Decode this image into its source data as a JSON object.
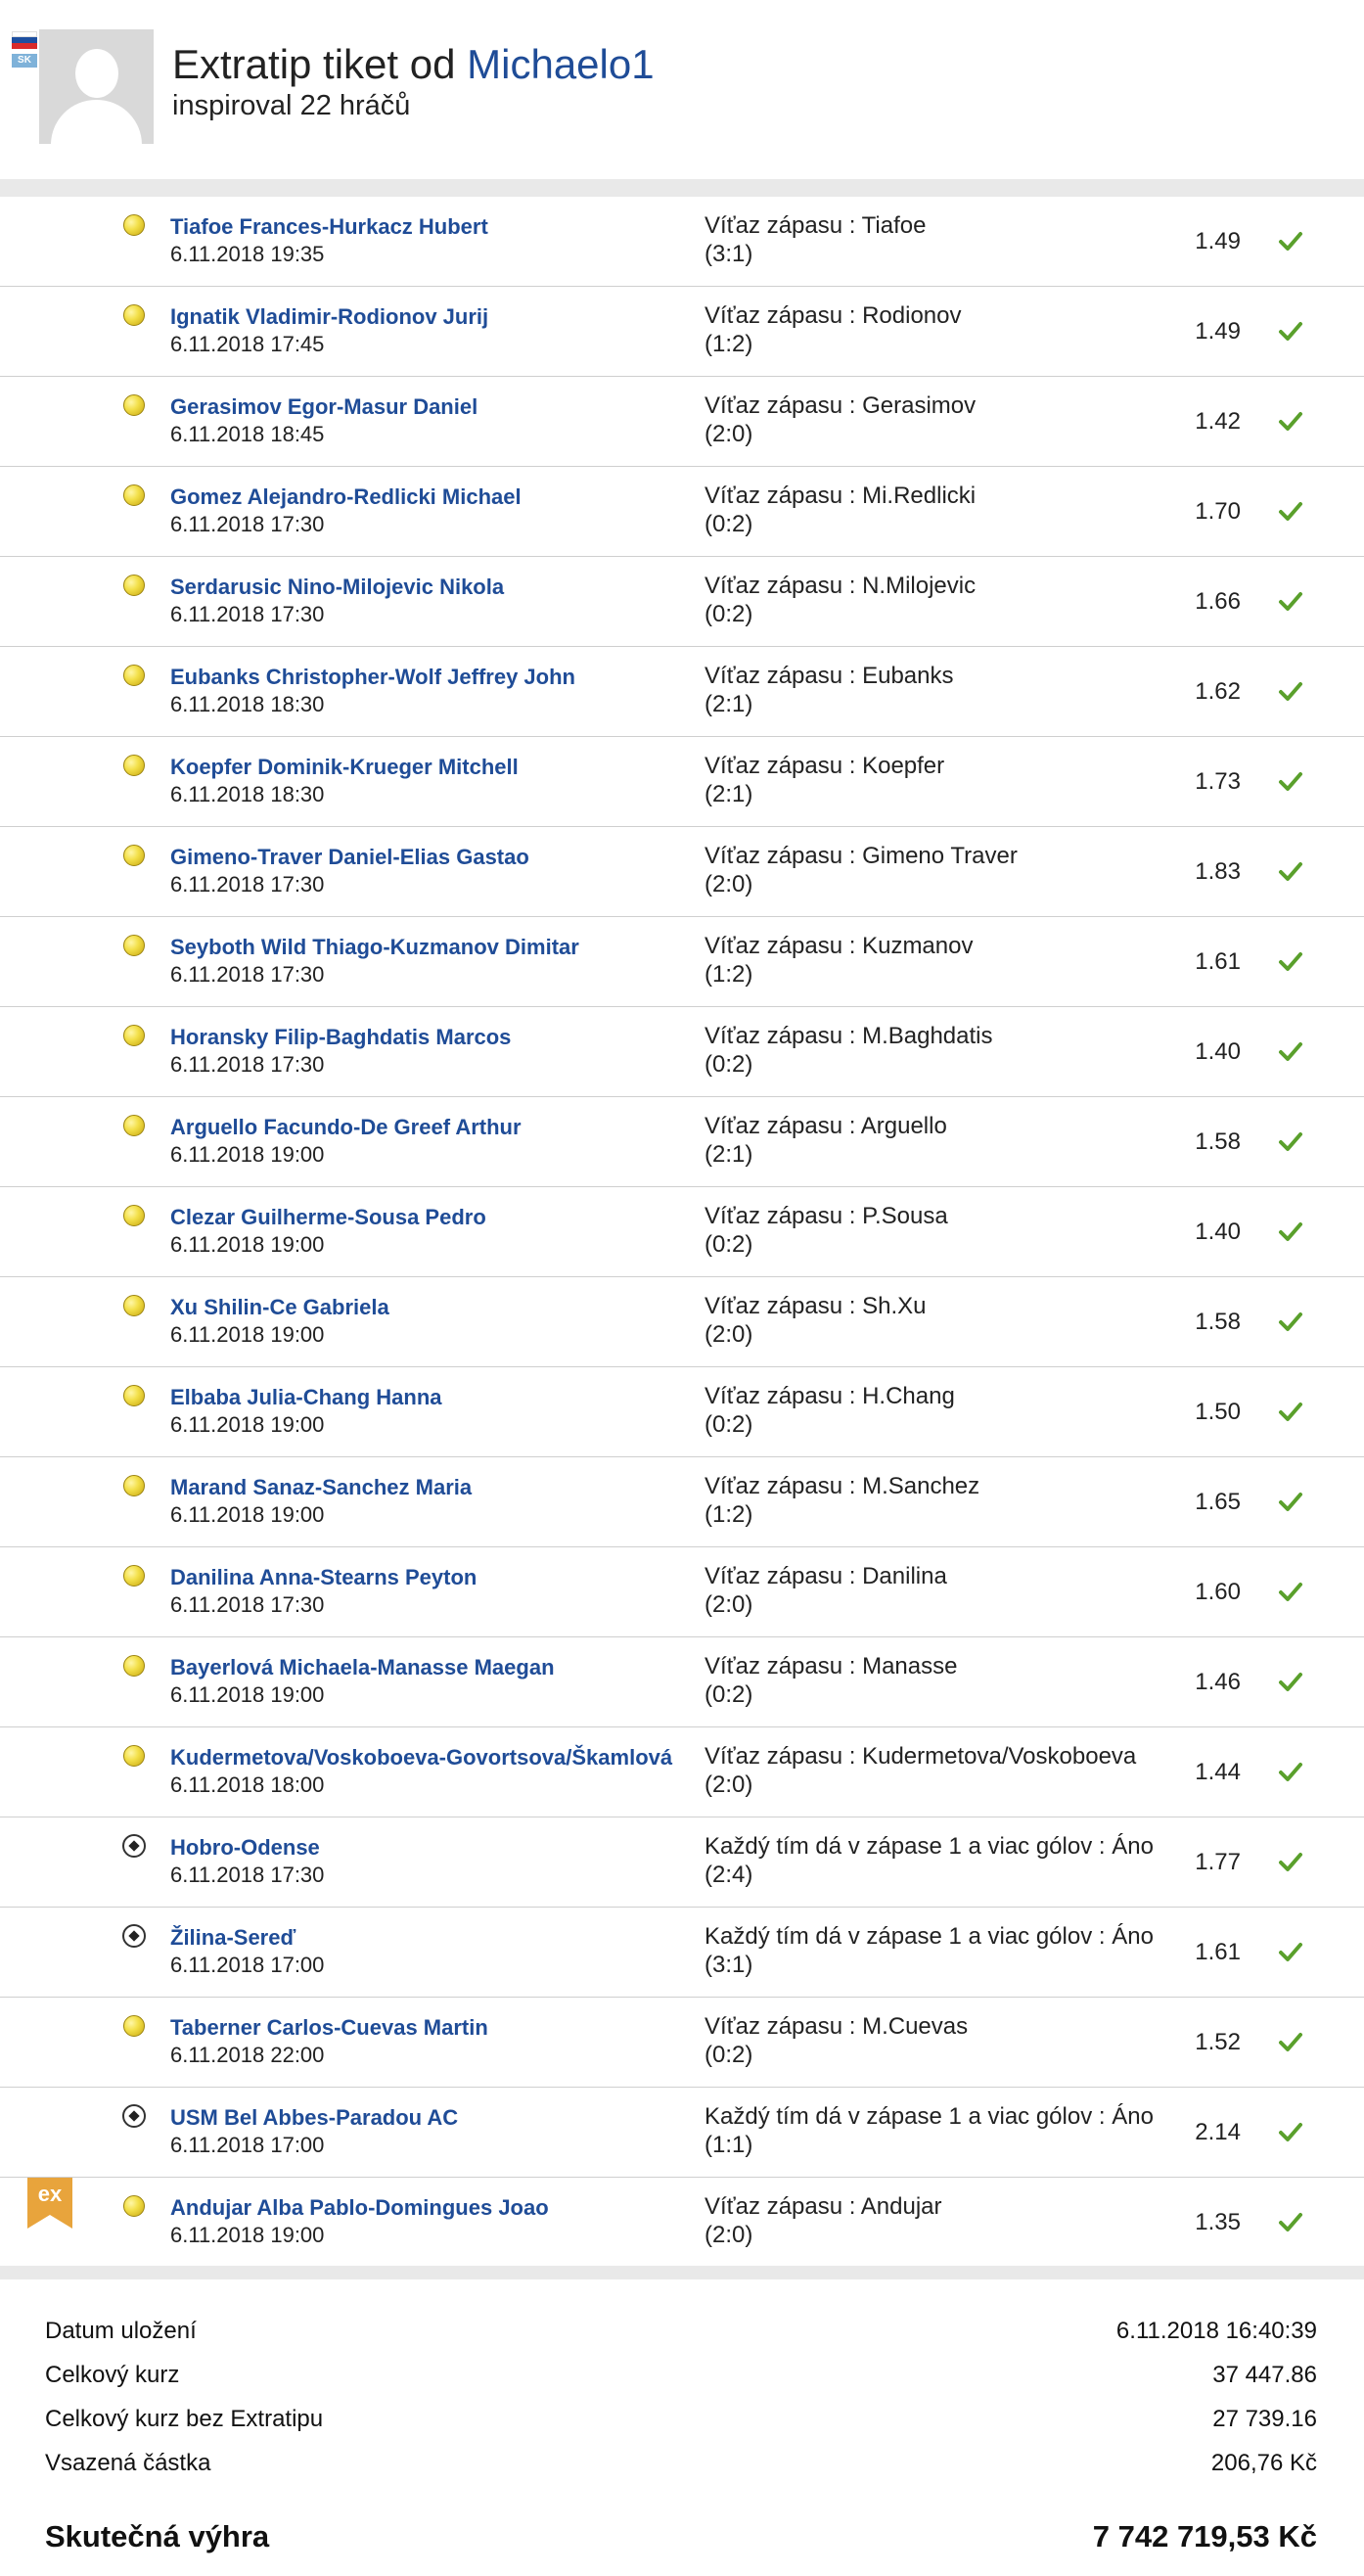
{
  "colors": {
    "link": "#1f4c97",
    "check": "#5aa02c",
    "band": "#e9e9e9",
    "badge": "#e8a43c"
  },
  "header": {
    "flag_code": "SK",
    "title_prefix": "Extratip tiket od",
    "author": "Michaelo1",
    "inspired_prefix": "inspiroval",
    "inspired_count": "22",
    "inspired_suffix": "hráčů"
  },
  "bets": [
    {
      "sport": "tennis-ball-icon",
      "match": "Tiafoe Frances-Hurkacz Hubert",
      "date": "6.11.2018 19:35",
      "pick": "Víťaz zápasu : Tiafoe",
      "score": "(3:1)",
      "odds": "1.49",
      "badge": ""
    },
    {
      "sport": "tennis-ball-icon",
      "match": "Ignatik Vladimir-Rodionov Jurij",
      "date": "6.11.2018 17:45",
      "pick": "Víťaz zápasu : Rodionov",
      "score": "(1:2)",
      "odds": "1.49",
      "badge": ""
    },
    {
      "sport": "tennis-ball-icon",
      "match": "Gerasimov Egor-Masur Daniel",
      "date": "6.11.2018 18:45",
      "pick": "Víťaz zápasu : Gerasimov",
      "score": "(2:0)",
      "odds": "1.42",
      "badge": ""
    },
    {
      "sport": "tennis-ball-icon",
      "match": "Gomez Alejandro-Redlicki Michael",
      "date": "6.11.2018 17:30",
      "pick": "Víťaz zápasu : Mi.Redlicki",
      "score": "(0:2)",
      "odds": "1.70",
      "badge": ""
    },
    {
      "sport": "tennis-ball-icon",
      "match": "Serdarusic Nino-Milojevic Nikola",
      "date": "6.11.2018 17:30",
      "pick": "Víťaz zápasu : N.Milojevic",
      "score": "(0:2)",
      "odds": "1.66",
      "badge": ""
    },
    {
      "sport": "tennis-ball-icon",
      "match": "Eubanks Christopher-Wolf Jeffrey John",
      "date": "6.11.2018 18:30",
      "pick": "Víťaz zápasu : Eubanks",
      "score": "(2:1)",
      "odds": "1.62",
      "badge": ""
    },
    {
      "sport": "tennis-ball-icon",
      "match": "Koepfer Dominik-Krueger Mitchell",
      "date": "6.11.2018 18:30",
      "pick": "Víťaz zápasu : Koepfer",
      "score": "(2:1)",
      "odds": "1.73",
      "badge": ""
    },
    {
      "sport": "tennis-ball-icon",
      "match": "Gimeno-Traver Daniel-Elias Gastao",
      "date": "6.11.2018 17:30",
      "pick": "Víťaz zápasu : Gimeno Traver",
      "score": "(2:0)",
      "odds": "1.83",
      "badge": ""
    },
    {
      "sport": "tennis-ball-icon",
      "match": "Seyboth Wild Thiago-Kuzmanov Dimitar",
      "date": "6.11.2018 17:30",
      "pick": "Víťaz zápasu : Kuzmanov",
      "score": "(1:2)",
      "odds": "1.61",
      "badge": ""
    },
    {
      "sport": "tennis-ball-icon",
      "match": "Horansky Filip-Baghdatis Marcos",
      "date": "6.11.2018 17:30",
      "pick": "Víťaz zápasu : M.Baghdatis",
      "score": "(0:2)",
      "odds": "1.40",
      "badge": ""
    },
    {
      "sport": "tennis-ball-icon",
      "match": "Arguello Facundo-De Greef Arthur",
      "date": "6.11.2018 19:00",
      "pick": "Víťaz zápasu : Arguello",
      "score": "(2:1)",
      "odds": "1.58",
      "badge": ""
    },
    {
      "sport": "tennis-ball-icon",
      "match": "Clezar Guilherme-Sousa Pedro",
      "date": "6.11.2018 19:00",
      "pick": "Víťaz zápasu : P.Sousa",
      "score": "(0:2)",
      "odds": "1.40",
      "badge": ""
    },
    {
      "sport": "tennis-ball-icon",
      "match": "Xu Shilin-Ce Gabriela",
      "date": "6.11.2018 19:00",
      "pick": "Víťaz zápasu : Sh.Xu",
      "score": "(2:0)",
      "odds": "1.58",
      "badge": ""
    },
    {
      "sport": "tennis-ball-icon",
      "match": "Elbaba Julia-Chang Hanna",
      "date": "6.11.2018 19:00",
      "pick": "Víťaz zápasu : H.Chang",
      "score": "(0:2)",
      "odds": "1.50",
      "badge": ""
    },
    {
      "sport": "tennis-ball-icon",
      "match": "Marand Sanaz-Sanchez Maria",
      "date": "6.11.2018 19:00",
      "pick": "Víťaz zápasu : M.Sanchez",
      "score": "(1:2)",
      "odds": "1.65",
      "badge": ""
    },
    {
      "sport": "tennis-ball-icon",
      "match": "Danilina Anna-Stearns Peyton",
      "date": "6.11.2018 17:30",
      "pick": "Víťaz zápasu : Danilina",
      "score": "(2:0)",
      "odds": "1.60",
      "badge": ""
    },
    {
      "sport": "tennis-ball-icon",
      "match": "Bayerlová Michaela-Manasse Maegan",
      "date": "6.11.2018 19:00",
      "pick": "Víťaz zápasu : Manasse",
      "score": "(0:2)",
      "odds": "1.46",
      "badge": ""
    },
    {
      "sport": "tennis-ball-icon",
      "match": "Kudermetova/Voskoboeva-Govortsova/Škamlová",
      "date": "6.11.2018 18:00",
      "pick": "Víťaz zápasu : Kudermetova/Voskoboeva",
      "score": "(2:0)",
      "odds": "1.44",
      "badge": ""
    },
    {
      "sport": "soccer-ball-icon",
      "match": "Hobro-Odense",
      "date": "6.11.2018 17:30",
      "pick": "Každý tím dá v zápase 1 a viac gólov : Áno",
      "score": "(2:4)",
      "odds": "1.77",
      "badge": ""
    },
    {
      "sport": "soccer-ball-icon",
      "match": "Žilina-Sereď",
      "date": "6.11.2018 17:00",
      "pick": "Každý tím dá v zápase 1 a viac gólov : Áno",
      "score": "(3:1)",
      "odds": "1.61",
      "badge": ""
    },
    {
      "sport": "tennis-ball-icon",
      "match": "Taberner Carlos-Cuevas Martin",
      "date": "6.11.2018 22:00",
      "pick": "Víťaz zápasu : M.Cuevas",
      "score": "(0:2)",
      "odds": "1.52",
      "badge": ""
    },
    {
      "sport": "soccer-ball-icon",
      "match": "USM Bel Abbes-Paradou AC",
      "date": "6.11.2018 17:00",
      "pick": "Každý tím dá v zápase 1 a viac gólov : Áno",
      "score": "(1:1)",
      "odds": "2.14",
      "badge": ""
    },
    {
      "sport": "tennis-ball-icon",
      "match": "Andujar Alba Pablo-Domingues Joao",
      "date": "6.11.2018 19:00",
      "pick": "Víťaz zápasu : Andujar",
      "score": "(2:0)",
      "odds": "1.35",
      "badge": "ex"
    }
  ],
  "summary": {
    "rows": [
      {
        "label": "Datum uložení",
        "value": "6.11.2018 16:40:39"
      },
      {
        "label": "Celkový kurz",
        "value": "37 447.86"
      },
      {
        "label": "Celkový kurz bez Extratipu",
        "value": "27 739.16"
      },
      {
        "label": "Vsazená částka",
        "value": "206,76 Kč"
      }
    ],
    "win_label": "Skutečná výhra",
    "win_value": "7 742 719,53 Kč"
  }
}
